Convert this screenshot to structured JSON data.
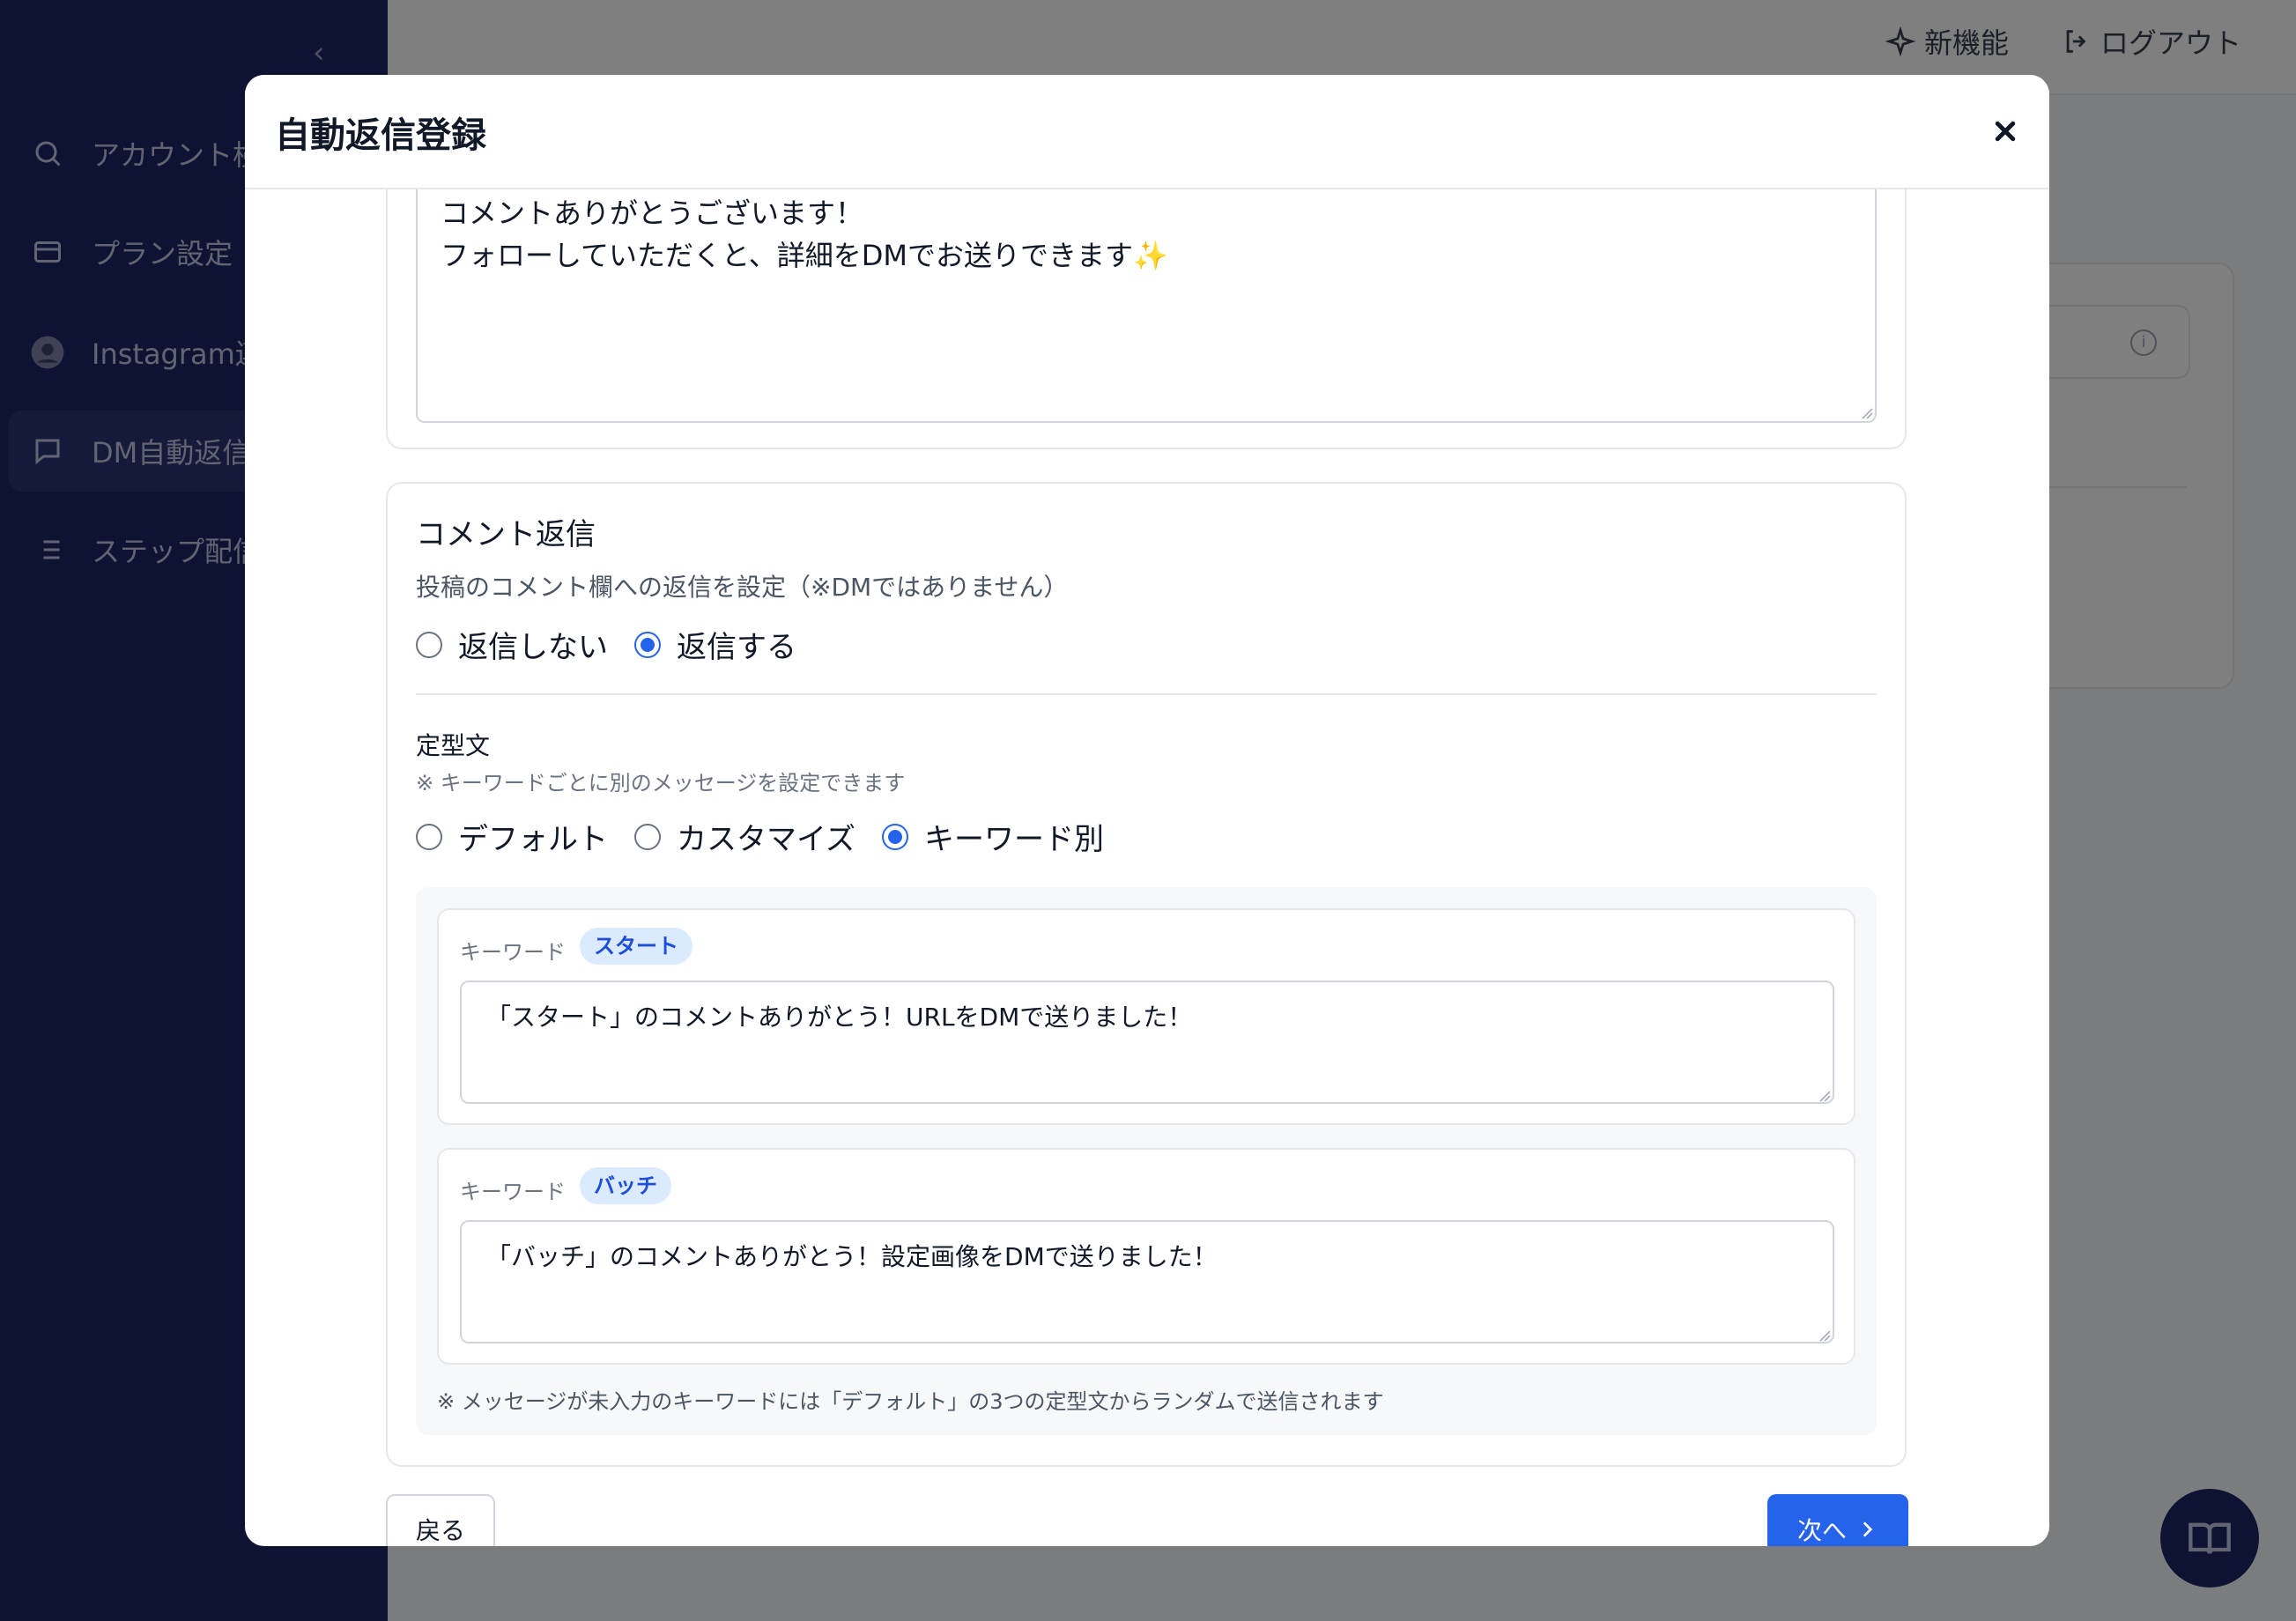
{
  "sidebar": {
    "items": [
      {
        "label": "アカウント検",
        "icon": "search-icon"
      },
      {
        "label": "プラン設定",
        "icon": "credit-card-icon"
      },
      {
        "label": "Instagram連",
        "icon": "avatar-icon"
      },
      {
        "label": "DM自動返信",
        "icon": "chat-icon"
      },
      {
        "label": "ステップ配信",
        "icon": "list-icon"
      }
    ]
  },
  "topbar": {
    "new_features": "新機能",
    "logout": "ログアウト"
  },
  "modal": {
    "title": "自動返信登録",
    "message_lines": [
      "コメントありがとうございます！",
      "フォローしていただくと、詳細をDMでお送りできます✨"
    ],
    "comment_reply": {
      "title": "コメント返信",
      "description": "投稿のコメント欄への返信を設定（※DMではありません）",
      "options": [
        {
          "label": "返信しない",
          "checked": false
        },
        {
          "label": "返信する",
          "checked": true
        }
      ],
      "template_label": "定型文",
      "template_note": "※ キーワードごとに別のメッセージを設定できます",
      "template_options": [
        {
          "label": "デフォルト",
          "checked": false
        },
        {
          "label": "カスタマイズ",
          "checked": false
        },
        {
          "label": "キーワード別",
          "checked": true
        }
      ],
      "keywords": [
        {
          "label": "キーワード",
          "keyword": "スタート",
          "message": "「スタート」のコメントありがとう！URLをDMで送りました！"
        },
        {
          "label": "キーワード",
          "keyword": "バッチ",
          "message": "「バッチ」のコメントありがとう！設定画像をDMで送りました！"
        }
      ],
      "footnote": "※ メッセージが未入力のキーワードには「デフォルト」の3つの定型文からランダムで送信されます"
    },
    "back_label": "戻る",
    "next_label": "次へ"
  },
  "colors": {
    "primary": "#2563eb",
    "sidebar_bg": "#1c2766",
    "badge_bg": "#dbeafe",
    "badge_text": "#1d4ed8"
  }
}
